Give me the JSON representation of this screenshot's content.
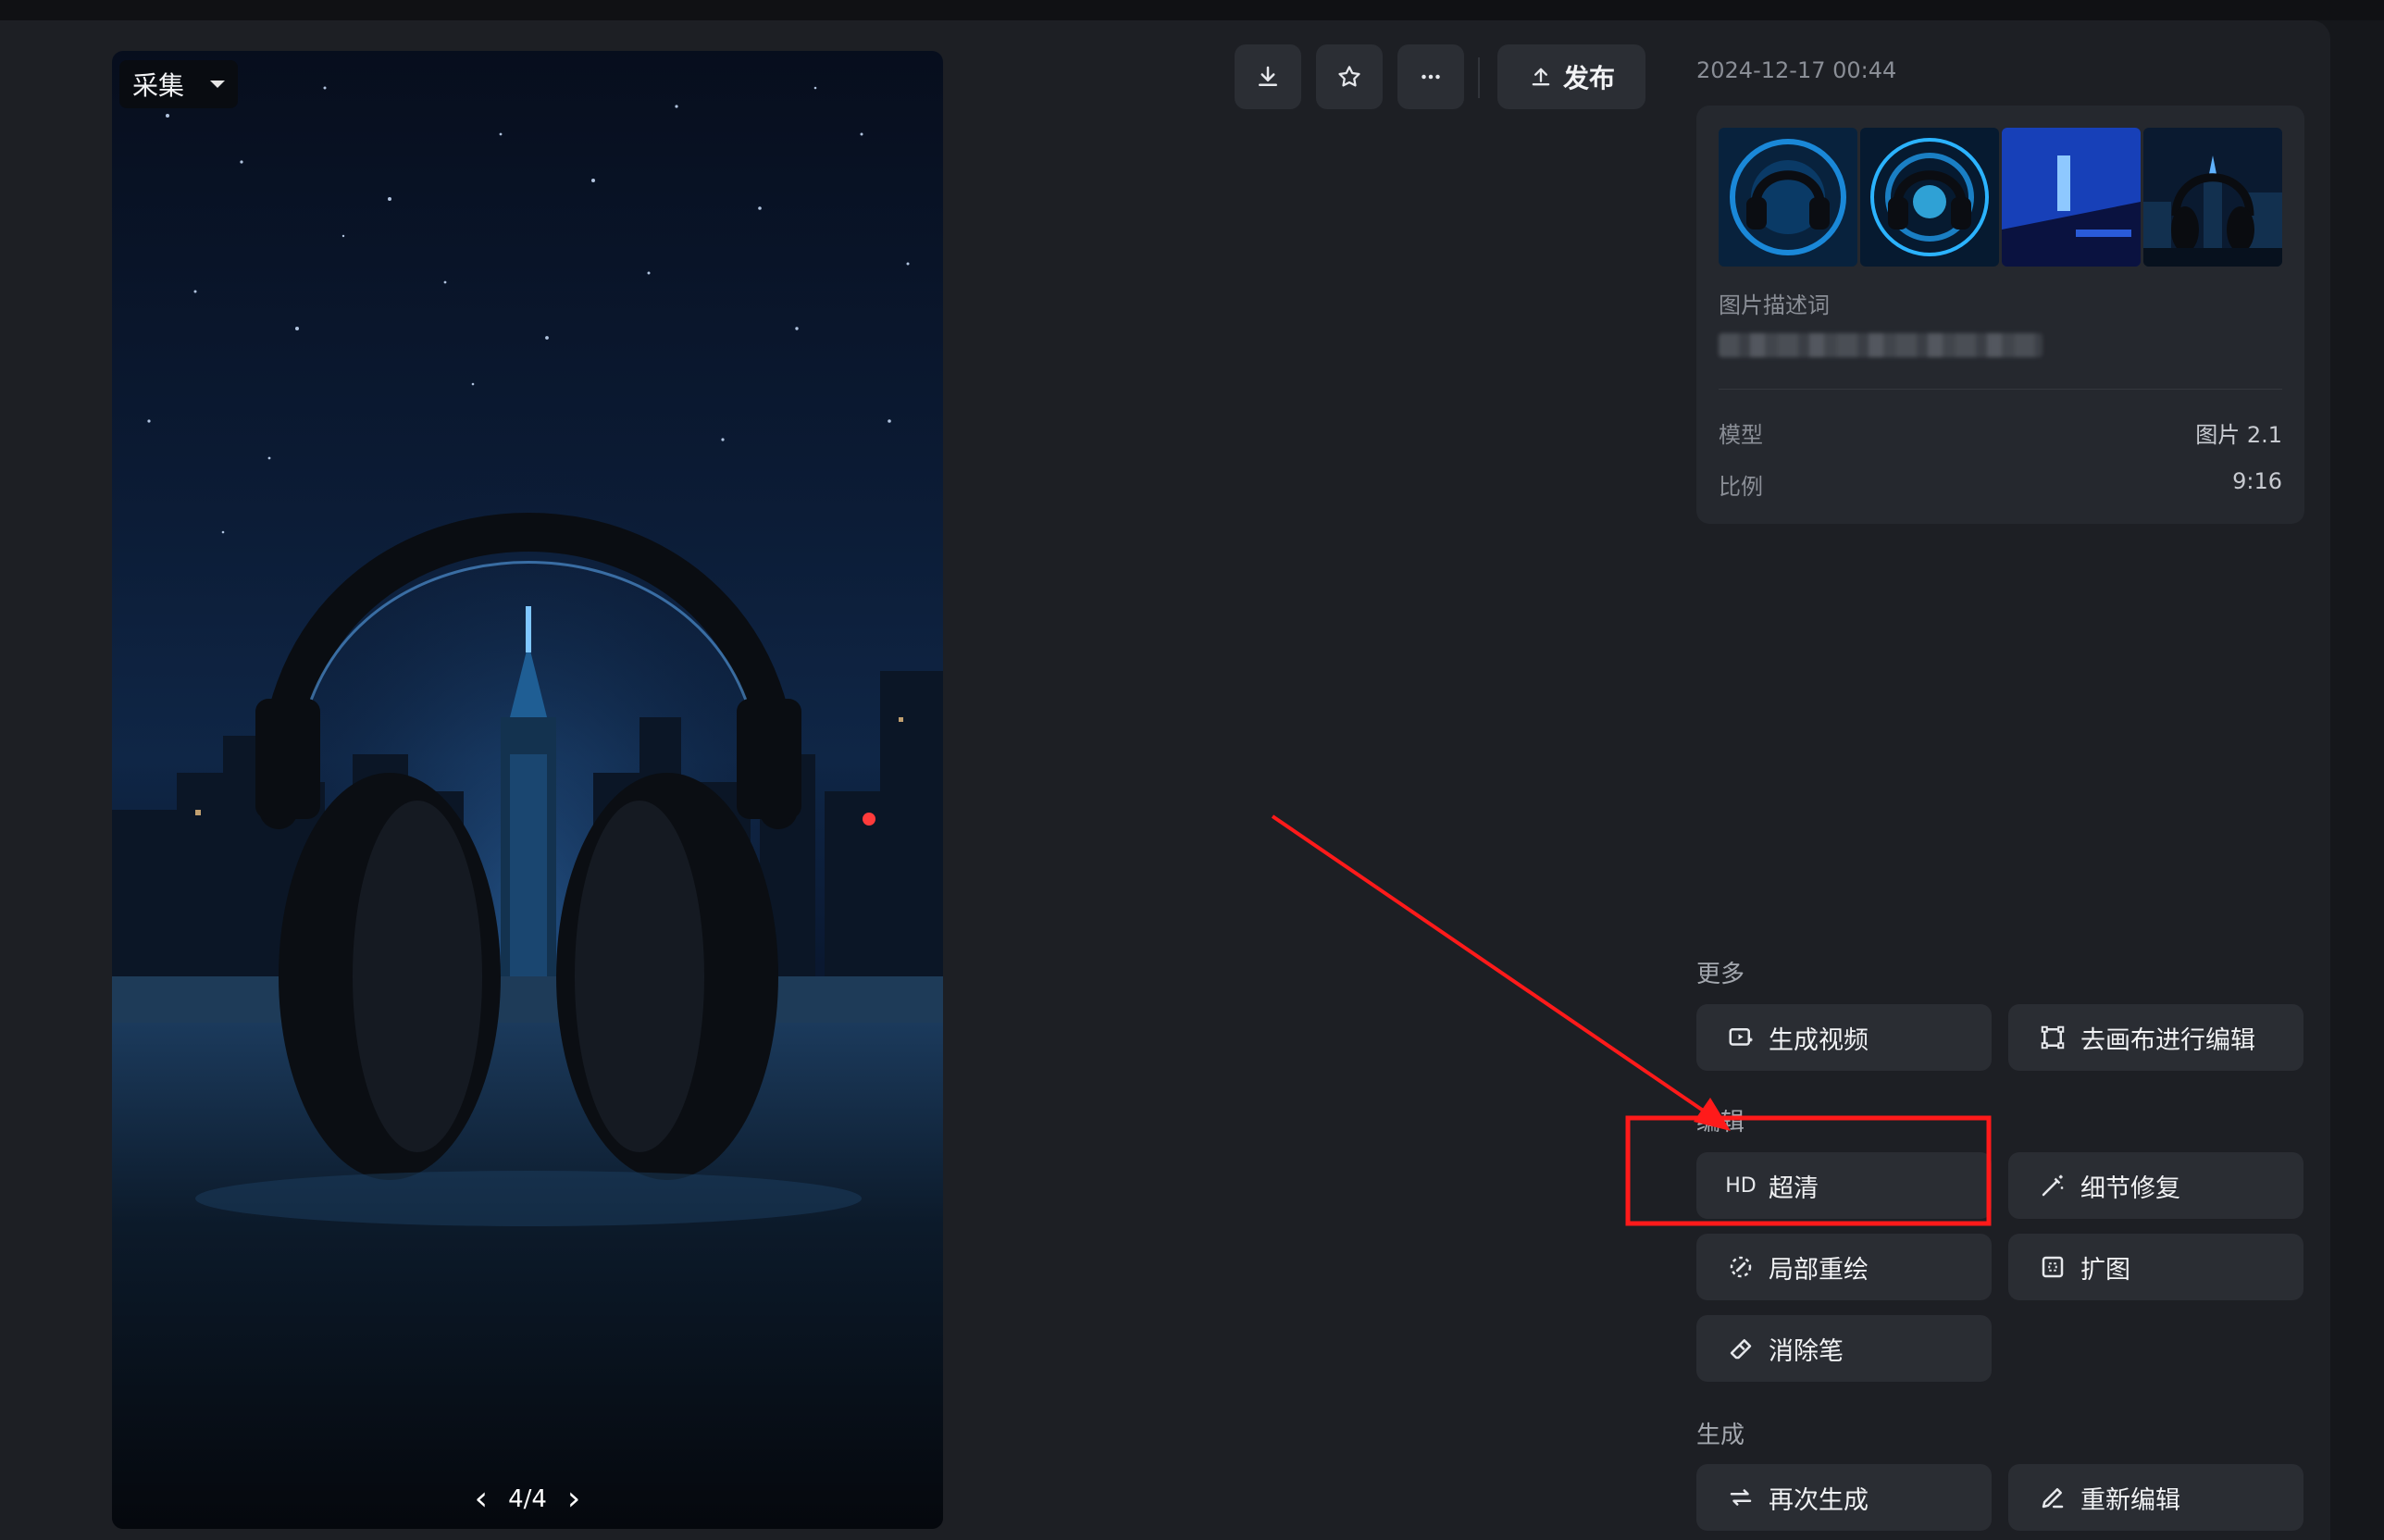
{
  "image_viewer": {
    "collect_label": "采集",
    "pager": {
      "current": "4/4"
    }
  },
  "toolbar": {
    "download_icon": "download-icon",
    "favorite_icon": "star-icon",
    "more_icon": "more-icon",
    "publish_label": "发布"
  },
  "info": {
    "timestamp": "2024-12-17 00:44",
    "description_label": "图片描述词",
    "meta": [
      {
        "key": "模型",
        "value": "图片 2.1"
      },
      {
        "key": "比例",
        "value": "9:16"
      }
    ]
  },
  "sections": {
    "more": {
      "title": "更多",
      "actions": [
        {
          "label": "生成视频",
          "icon": "video-generate-icon"
        },
        {
          "label": "去画布进行编辑",
          "icon": "canvas-edit-icon"
        }
      ]
    },
    "edit": {
      "title": "编辑",
      "actions": [
        {
          "label": "超清",
          "icon": "hd-icon",
          "icon_text": "HD"
        },
        {
          "label": "细节修复",
          "icon": "magic-wand-icon"
        },
        {
          "label": "局部重绘",
          "icon": "inpaint-icon"
        },
        {
          "label": "扩图",
          "icon": "expand-icon"
        },
        {
          "label": "消除笔",
          "icon": "eraser-icon"
        }
      ]
    },
    "generate": {
      "title": "生成",
      "actions": [
        {
          "label": "再次生成",
          "icon": "regenerate-icon"
        },
        {
          "label": "重新编辑",
          "icon": "pencil-icon"
        }
      ]
    }
  },
  "colors": {
    "background": "#1d1f24",
    "card": "#25282e",
    "button": "#2a2d33",
    "annotation_red": "#ff1a1a"
  }
}
